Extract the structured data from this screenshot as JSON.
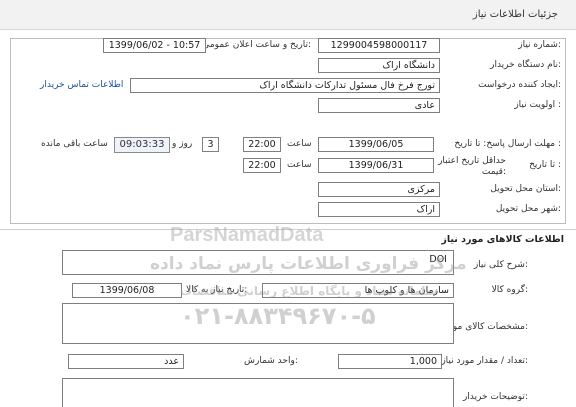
{
  "header": {
    "title": "جزئیات اطلاعات نیاز"
  },
  "fields": {
    "need_number": {
      "label": "شماره نیاز:",
      "value": "1299004598000117"
    },
    "announce_datetime": {
      "label": "تاریخ و ساعت اعلان عمومی:",
      "value": "1399/06/02 - 10:57"
    },
    "buyer_org": {
      "label": "نام دستگاه خریدار:",
      "value": "دانشگاه اراک"
    },
    "creator": {
      "label": "ایجاد کننده درخواست:",
      "value": "تورج فرخ فال مسئول تدارکات دانشگاه اراک"
    },
    "buyer_contact_link": "اطلاعات تماس خریدار",
    "priority": {
      "label": "اولویت نیاز :",
      "value": "عادی"
    },
    "reply_deadline": {
      "label": "مهلت ارسال پاسخ: تا تاریخ :",
      "date": "1399/06/05",
      "time_label": "ساعت",
      "time": "22:00",
      "days": "3",
      "days_label": "روز و",
      "countdown": "09:03:33",
      "remaining_label": "ساعت باقی مانده"
    },
    "price_validity": {
      "label_line1": "حداقل تاریخ اعتبار",
      "label_line2": "قیمت:",
      "to_date_label": "تا تاریخ :",
      "date": "1399/06/31",
      "time_label": "ساعت",
      "time": "22:00"
    },
    "delivery_province": {
      "label": "استان محل تحویل:",
      "value": "مرکزی"
    },
    "delivery_city": {
      "label": "شهر محل تحویل:",
      "value": "اراک"
    }
  },
  "goods": {
    "section_title": "اطلاعات کالاهای مورد نیاز",
    "summary": {
      "label": "شرح کلی نیاز:",
      "value": "DOI"
    },
    "group": {
      "label": "گروه کالا:",
      "value": "سازمان ها و کلوپ ها",
      "need_date_label": "تاریخ نیاز به کالا:",
      "need_date": "1399/06/08"
    },
    "spec": {
      "label": "مشخصات کالای مورد نیاز:"
    },
    "quantity": {
      "label": "تعداد / مقدار مورد نیاز:",
      "value": "1,000",
      "unit_label": "واحد شمارش:",
      "unit": "عدد"
    },
    "buyer_notes": {
      "label": "توضیحات خریدار:"
    }
  },
  "watermark": {
    "brand": "ParsNamadData",
    "line1": "مرکز فراوری اطلاعات پارس نماد داده",
    "line2": "سامانه ستاد و پایگاه اطلاع رسانی مناقصات",
    "phone": "۰۲۱-۸۸۳۴۹۶۷۰-۵"
  },
  "colors": {
    "header_bg": "#f2f2f2",
    "link": "#1a4fa0",
    "timer_bg": "#eef2fa",
    "border": "#7f7f7f"
  }
}
